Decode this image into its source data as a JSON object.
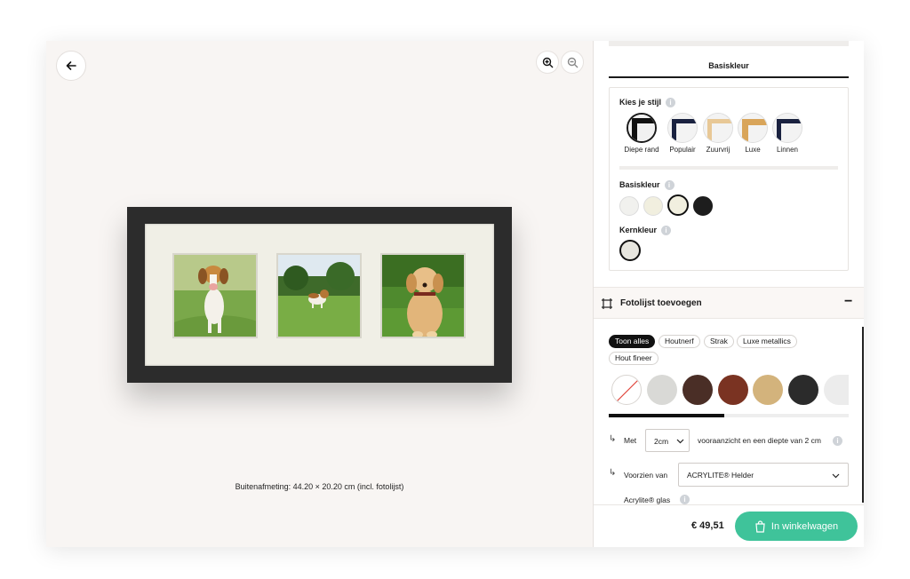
{
  "preview": {
    "dimensions_text": "Buitenafmeting: 44.20 × 20.20 cm (incl. fotolijst)"
  },
  "panel": {
    "tab_label": "Basiskleur",
    "style_section": {
      "label": "Kies je stijl",
      "options": [
        "Diepe rand",
        "Populair",
        "Zuurvrij",
        "Luxe",
        "Linnen"
      ]
    },
    "base_color_label": "Basiskleur",
    "core_color_label": "Kernkleur",
    "frame_section_title": "Fotolijst toevoegen",
    "filters": [
      "Toon alles",
      "Houtnerf",
      "Strak",
      "Luxe metallics",
      "Hout fineer"
    ],
    "depth_row": {
      "prefix": "Met",
      "selected": "2cm",
      "suffix": "vooraanzicht en een diepte van 2 cm"
    },
    "glass_row": {
      "prefix": "Voorzien van",
      "selected": "ACRYLITE® Helder",
      "sub_label": "Acrylite® glas"
    },
    "info_glyph": "i",
    "collapse_glyph": "−",
    "arrow_glyph": "↳",
    "price": "€ 49,51",
    "cart_label": "In winkelwagen"
  },
  "colors": {
    "accent": "#3fc39a",
    "frame_black": "#2c2c2c",
    "passe_partout": "#f0efe6"
  }
}
